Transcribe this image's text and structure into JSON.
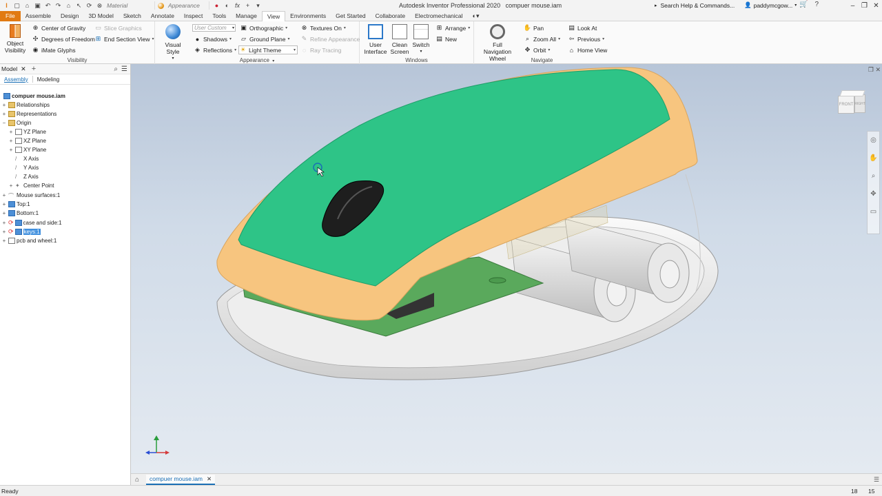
{
  "titlebar": {
    "material_label": "Material",
    "appearance_label": "Appearance",
    "app_name": "Autodesk Inventor Professional 2020",
    "doc_name": "compuer mouse.iam",
    "search_placeholder": "Search Help & Commands...",
    "username": "paddymcgow..."
  },
  "tabs": [
    "File",
    "Assemble",
    "Design",
    "3D Model",
    "Sketch",
    "Annotate",
    "Inspect",
    "Tools",
    "Manage",
    "View",
    "Environments",
    "Get Started",
    "Collaborate",
    "Electromechanical"
  ],
  "ribbon": {
    "visibility": {
      "object_visibility": "Object Visibility",
      "center_of_gravity": "Center of Gravity",
      "degrees_of_freedom": "Degrees of Freedom",
      "imate_glyphs": "iMate Glyphs",
      "slice_graphics": "Slice Graphics",
      "end_section_view": "End Section View",
      "label": "Visibility"
    },
    "appearance": {
      "visual_style": "Visual Style",
      "user_custom": "User Custom",
      "shadows": "Shadows",
      "reflections": "Reflections",
      "orthographic": "Orthographic",
      "ground_plane": "Ground Plane",
      "light_theme": "Light Theme",
      "textures_on": "Textures On",
      "refine_appearance": "Refine Appearance",
      "ray_tracing": "Ray Tracing",
      "label": "Appearance"
    },
    "windows": {
      "user_interface": "User Interface",
      "clean_screen": "Clean Screen",
      "switch": "Switch",
      "arrange": "Arrange",
      "new": "New",
      "label": "Windows"
    },
    "navigate": {
      "full_navigation_wheel": "Full Navigation Wheel",
      "pan": "Pan",
      "zoom_all": "Zoom All",
      "orbit": "Orbit",
      "look_at": "Look At",
      "previous": "Previous",
      "home_view": "Home View",
      "label": "Navigate"
    }
  },
  "browser": {
    "title": "Model",
    "subtabs": [
      "Assembly",
      "Modeling"
    ],
    "root": "compuer mouse.iam",
    "items": [
      {
        "label": "Relationships",
        "exp": "+"
      },
      {
        "label": "Representations",
        "exp": "+"
      },
      {
        "label": "Origin",
        "exp": "−"
      },
      {
        "label": "YZ Plane",
        "exp": "+"
      },
      {
        "label": "XZ Plane",
        "exp": "+"
      },
      {
        "label": "XY Plane",
        "exp": "+"
      },
      {
        "label": "X Axis",
        "exp": ""
      },
      {
        "label": "Y Axis",
        "exp": ""
      },
      {
        "label": "Z Axis",
        "exp": ""
      },
      {
        "label": "Center Point",
        "exp": "+"
      },
      {
        "label": "Mouse surfaces:1",
        "exp": "+"
      },
      {
        "label": "Top:1",
        "exp": "+"
      },
      {
        "label": "Bottom:1",
        "exp": "+"
      },
      {
        "label": "case and side:1",
        "exp": "+"
      },
      {
        "label": "keys:1",
        "exp": "+"
      },
      {
        "label": "pcb and wheel:1",
        "exp": "+"
      }
    ]
  },
  "viewcube": {
    "front": "FRONT",
    "right": "RIGHT"
  },
  "triad": {
    "x": "X",
    "y": "Y",
    "z": "Z"
  },
  "docbar": {
    "tab": "compuer mouse.iam"
  },
  "status": {
    "text": "Ready",
    "num1": "18",
    "num2": "15"
  },
  "colors": {
    "accent": "#e17a12",
    "top_shell": "#2ec487",
    "side_shell": "#f7c57f",
    "pcb": "#5aa95c",
    "base": "#f2f2f2"
  }
}
